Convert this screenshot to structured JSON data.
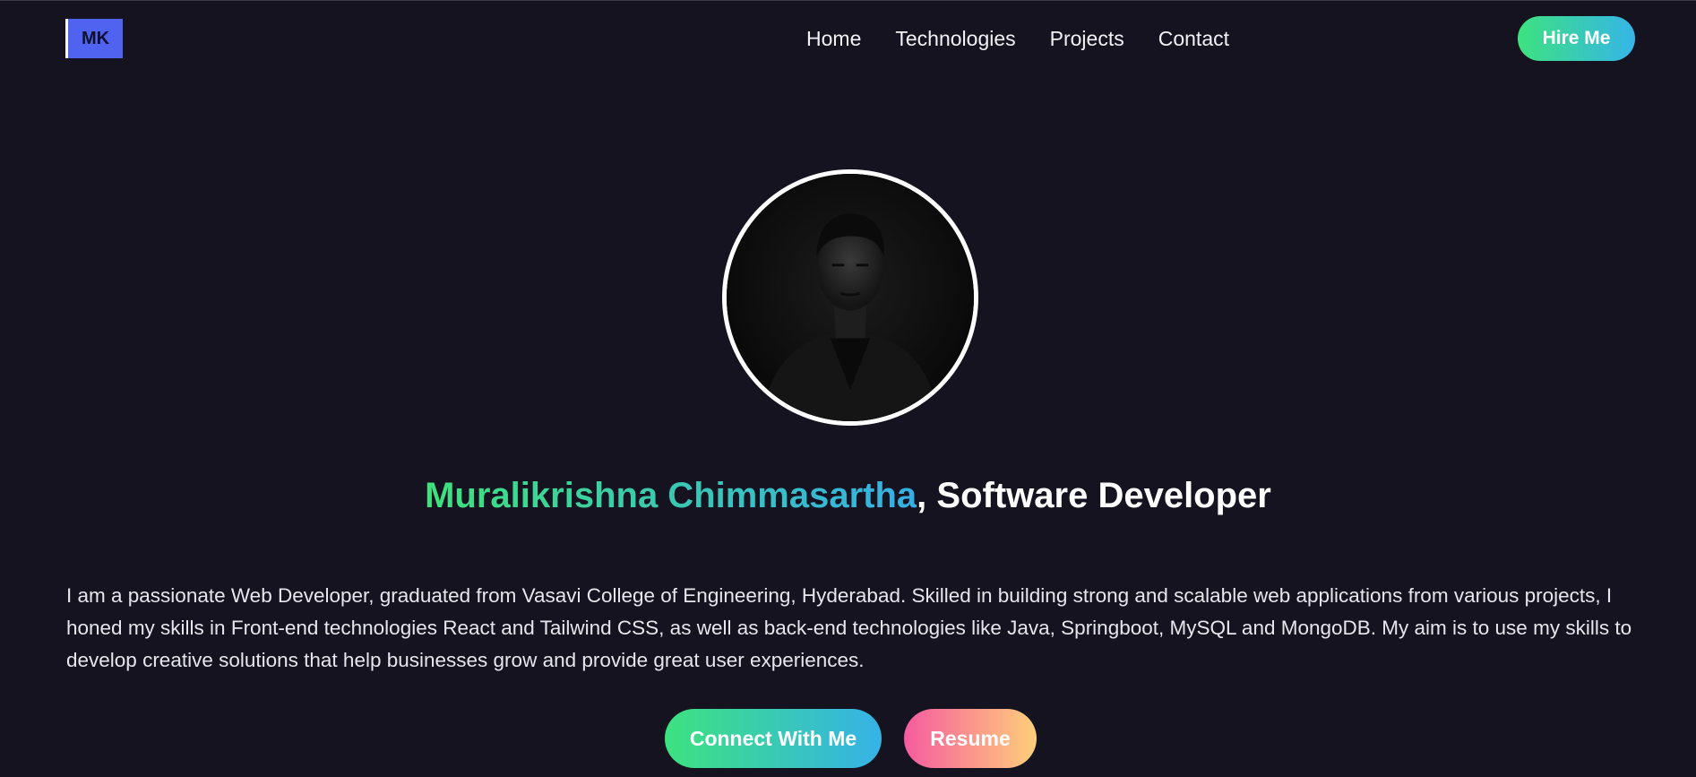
{
  "navbar": {
    "logo_text": "MK",
    "links": [
      {
        "label": "Home"
      },
      {
        "label": "Technologies"
      },
      {
        "label": "Projects"
      },
      {
        "label": "Contact"
      }
    ],
    "cta_label": "Hire Me"
  },
  "hero": {
    "name": "Muralikrishna Chimmasartha",
    "separator": ", ",
    "role": "Software Developer",
    "bio": "I am a passionate Web Developer, graduated from Vasavi College of Engineering, Hyderabad. Skilled in building strong and scalable web applications from various projects, I honed my skills in Front-end technologies React and Tailwind CSS, as well as back-end technologies like Java, Springboot, MySQL and MongoDB. My aim is to use my skills to develop creative solutions that help businesses grow and provide great user experiences.",
    "buttons": {
      "connect_label": "Connect With Me",
      "resume_label": "Resume"
    }
  },
  "colors": {
    "background": "#14131f",
    "logo_bg": "#4f63f0",
    "gradient_green": "#3de27f",
    "gradient_blue": "#35b2e8",
    "gradient_pink": "#f55b9f",
    "gradient_orange": "#ffcf7a"
  },
  "icons": {
    "profile_photo": "portrait-photo"
  }
}
